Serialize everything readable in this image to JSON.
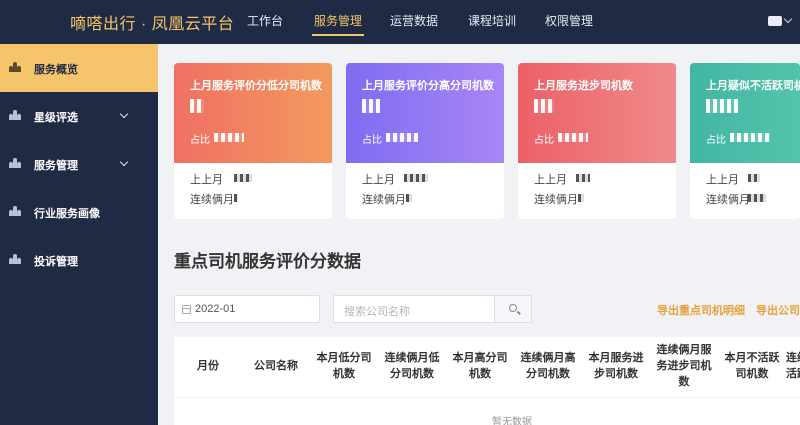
{
  "app": {
    "brand": "嘀嗒出行 · 凤凰云平台"
  },
  "topnav": {
    "items": [
      "工作台",
      "服务管理",
      "运营数据",
      "课程培训",
      "权限管理"
    ],
    "active": "服务管理"
  },
  "sidebar": {
    "items": [
      {
        "label": "服务概览",
        "icon": "users-icon",
        "active": true,
        "expandable": false
      },
      {
        "label": "星级评选",
        "icon": "users-icon",
        "active": false,
        "expandable": true
      },
      {
        "label": "服务管理",
        "icon": "users-icon",
        "active": false,
        "expandable": true
      },
      {
        "label": "行业服务画像",
        "icon": "users-icon",
        "active": false,
        "expandable": false
      },
      {
        "label": "投诉管理",
        "icon": "users-icon",
        "active": false,
        "expandable": false
      }
    ]
  },
  "cards": [
    {
      "title": "上月服务评价分低分司机数",
      "value_hidden": "obscured",
      "ratio_label": "占比",
      "prev_label": "上上月",
      "consecutive_label": "连续俩月",
      "color_from": "#f07064",
      "color_to": "#f29a5e"
    },
    {
      "title": "上月服务评价分高分司机数",
      "value_hidden": "obscured",
      "ratio_label": "占比",
      "prev_label": "上上月",
      "consecutive_label": "连续俩月",
      "color_from": "#7f6cf2",
      "color_to": "#a886f5"
    },
    {
      "title": "上月服务进步司机数",
      "value_hidden": "obscured",
      "ratio_label": "占比",
      "prev_label": "上上月",
      "consecutive_label": "连续俩月",
      "color_from": "#ec6069",
      "color_to": "#f08a8a"
    },
    {
      "title": "上月疑似不活跃司机数",
      "value_hidden": "obscured",
      "ratio_label": "占比",
      "prev_label": "上上月",
      "consecutive_label": "连续俩月",
      "color_from": "#42b6a4",
      "color_to": "#5cc9ae"
    }
  ],
  "section": {
    "title": "重点司机服务评价分数据"
  },
  "filters": {
    "date_value": "2022-01",
    "search_placeholder": "搜索公司名称"
  },
  "exports": [
    "导出重点司机明细",
    "导出公司统计"
  ],
  "table": {
    "columns": [
      "月份",
      "公司名称",
      "本月低分司\n机数",
      "连续俩月低\n分司机数",
      "本月高分司\n机数",
      "连续俩月高\n分司机数",
      "本月服务进\n步司机数",
      "连续俩月服\n务进步司机\n数",
      "本月不活跃\n司机数",
      "连续\n活跃"
    ],
    "empty_text": "暂无数据"
  },
  "colors": {
    "nav_bg": "#1f2a44",
    "accent": "#f6c56b",
    "export": "#e8a23a"
  }
}
